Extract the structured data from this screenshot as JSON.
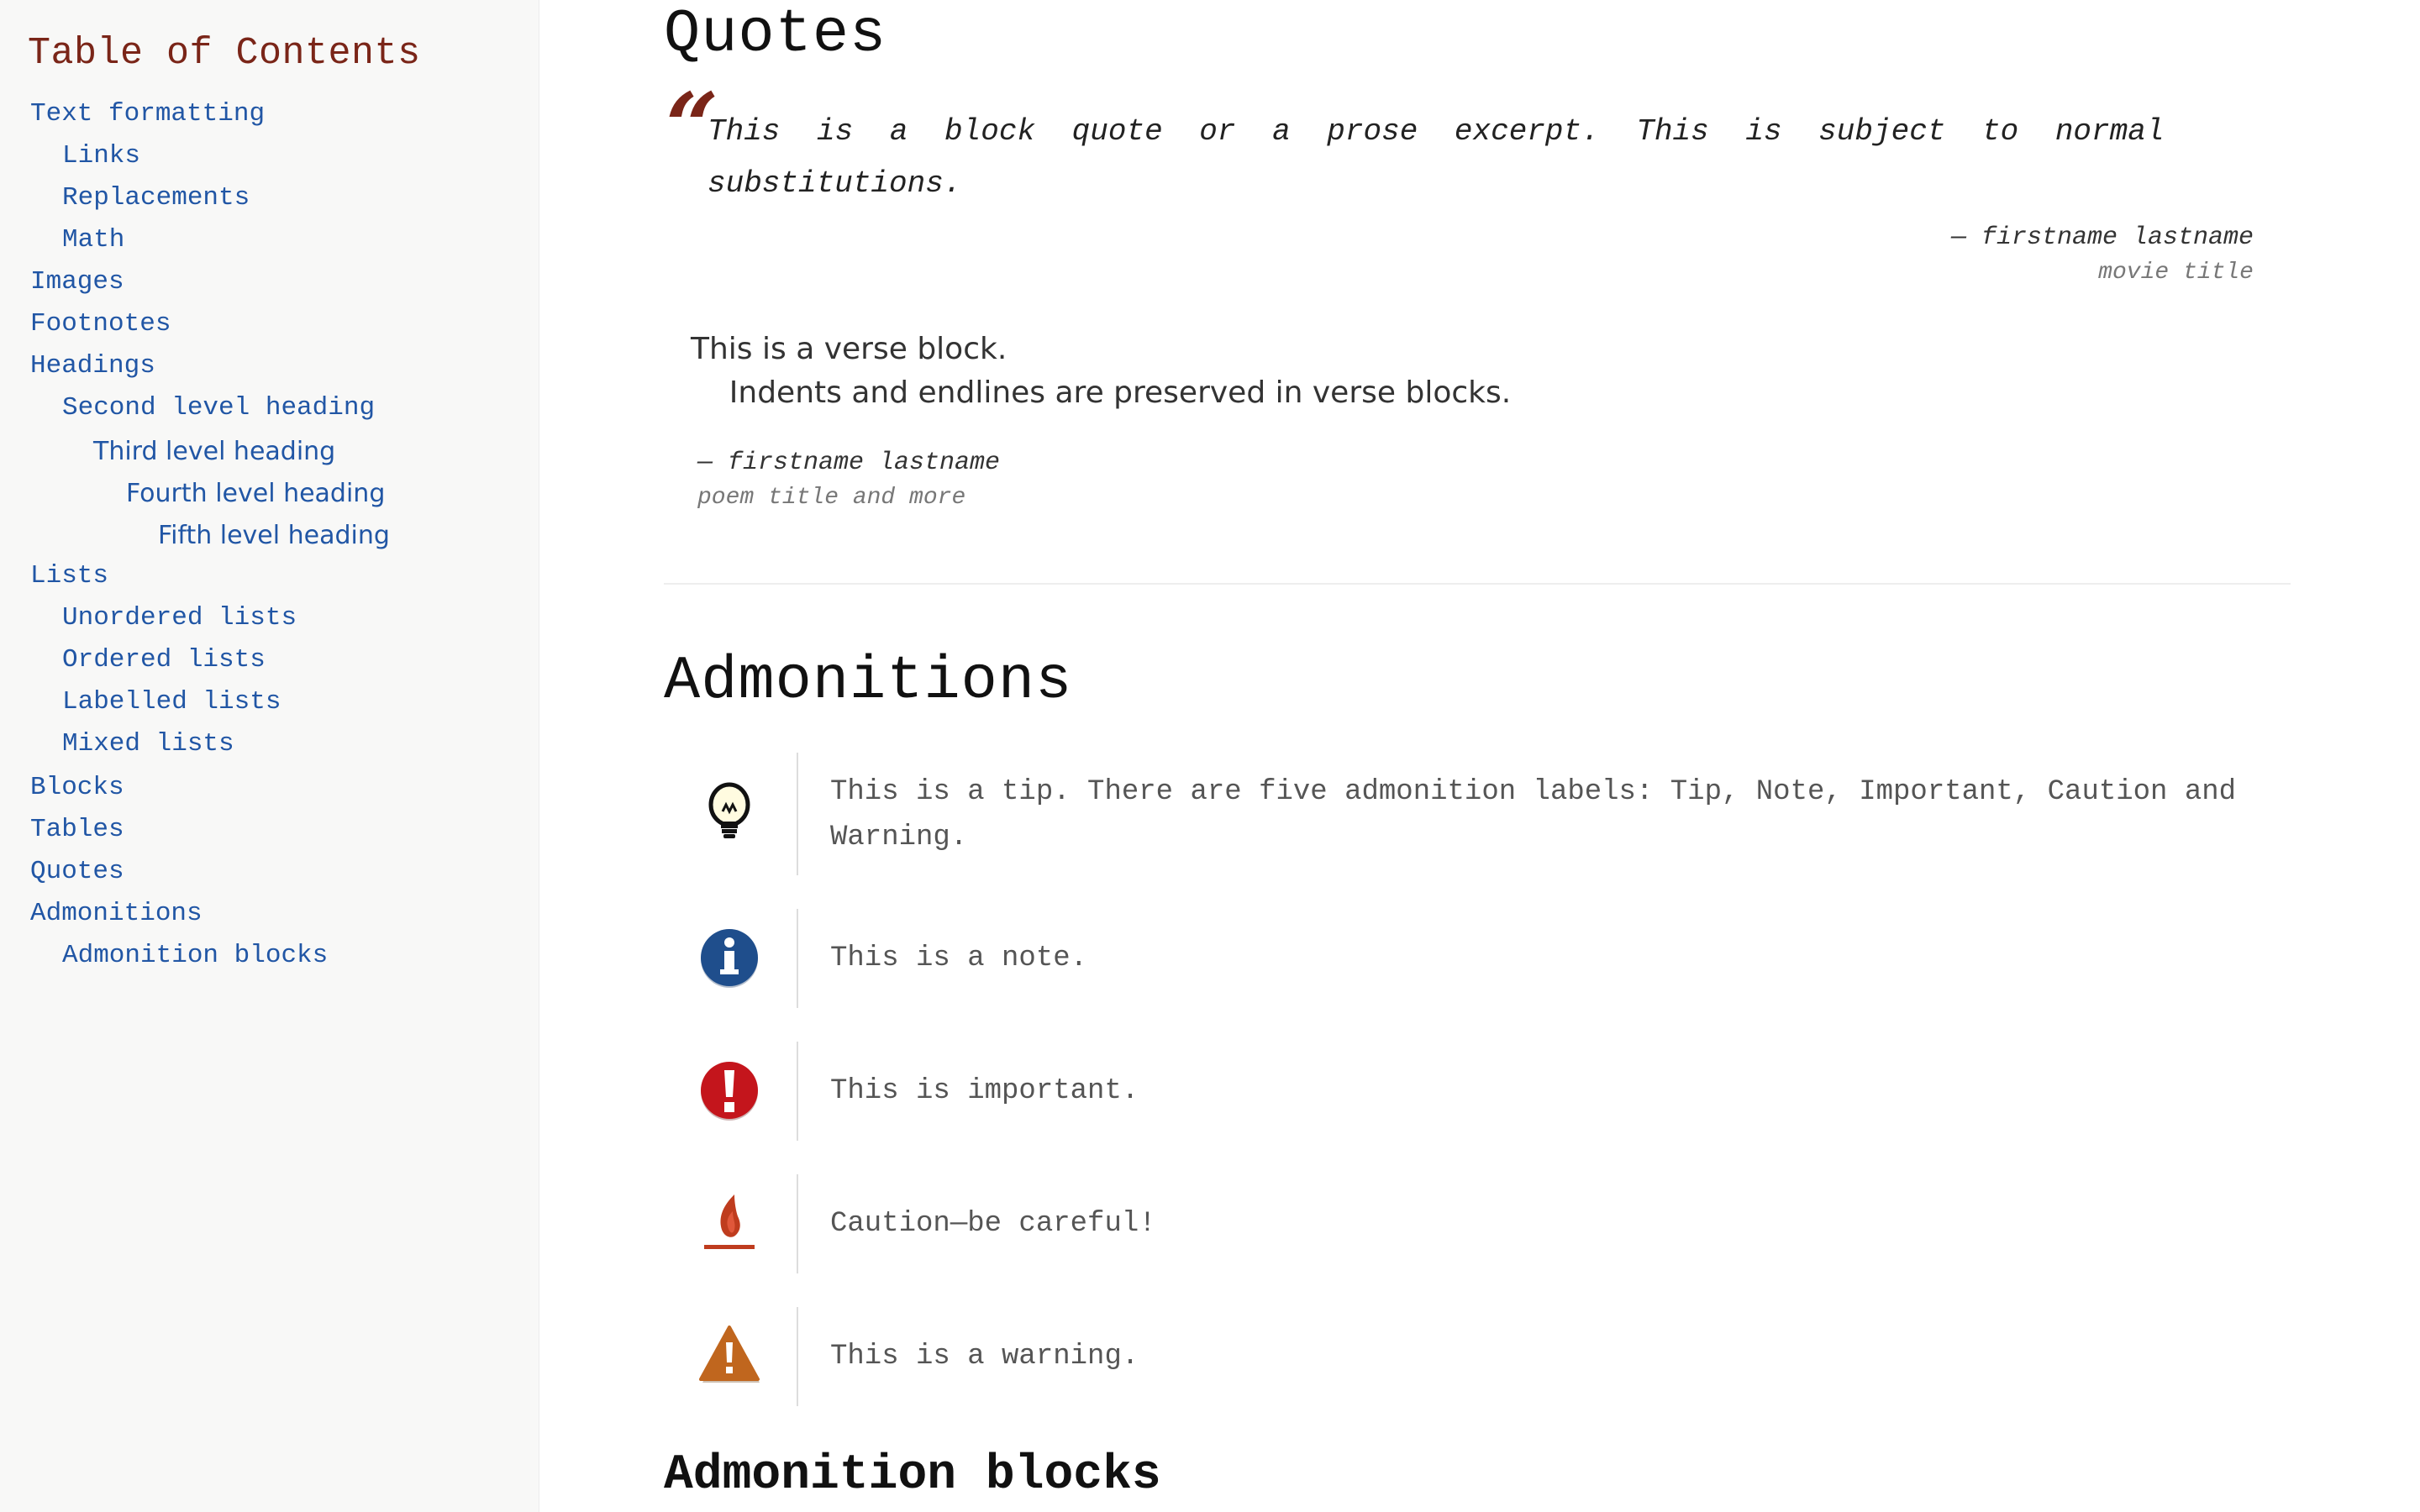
{
  "sidebar": {
    "title": "Table of Contents",
    "items": [
      {
        "label": "Text formatting"
      },
      {
        "label": "Links"
      },
      {
        "label": "Replacements"
      },
      {
        "label": "Math"
      },
      {
        "label": "Images"
      },
      {
        "label": "Footnotes"
      },
      {
        "label": "Headings"
      },
      {
        "label": "Second level heading"
      },
      {
        "label": "Third level heading"
      },
      {
        "label": "Fourth level heading"
      },
      {
        "label": "Fifth level heading"
      },
      {
        "label": "Lists"
      },
      {
        "label": "Unordered lists"
      },
      {
        "label": "Ordered lists"
      },
      {
        "label": "Labelled lists"
      },
      {
        "label": "Mixed lists"
      },
      {
        "label": "Blocks"
      },
      {
        "label": "Tables"
      },
      {
        "label": "Quotes"
      },
      {
        "label": "Admonitions"
      },
      {
        "label": "Admonition blocks"
      }
    ]
  },
  "main": {
    "quotes_heading": "Quotes",
    "quote": {
      "line1": "This is a block quote or a prose excerpt. This is subject to normal",
      "line2": "substitutions.",
      "author": "— firstname lastname",
      "cite": "movie title"
    },
    "verse": {
      "line1": "This is a verse block.",
      "line2": "    Indents and endlines are preserved in verse blocks.",
      "author": "— firstname lastname",
      "cite": "poem title and more"
    },
    "admonitions_heading": "Admonitions",
    "admonitions": [
      {
        "type": "tip",
        "icon": "lightbulb-icon",
        "line1": "This is a tip. There are five admonition labels: Tip, Note, Important, Caution and",
        "line2": "Warning."
      },
      {
        "type": "note",
        "icon": "info-icon",
        "line1": "This is a note.",
        "line2": ""
      },
      {
        "type": "important",
        "icon": "exclamation-icon",
        "line1": "This is important.",
        "line2": ""
      },
      {
        "type": "caution",
        "icon": "flame-icon",
        "line1": "Caution—be careful!",
        "line2": ""
      },
      {
        "type": "warning",
        "icon": "warning-triangle-icon",
        "line1": "This is a warning.",
        "line2": ""
      }
    ],
    "admonition_blocks_heading": "Admonition blocks"
  },
  "colors": {
    "link": "#2156a5",
    "toc_title": "#7a2518",
    "quote_mark": "#7a2518",
    "note_icon": "#1f4e8c",
    "important_icon": "#c4151c",
    "caution_icon": "#bf3c1e",
    "warning_icon": "#c0661e"
  }
}
